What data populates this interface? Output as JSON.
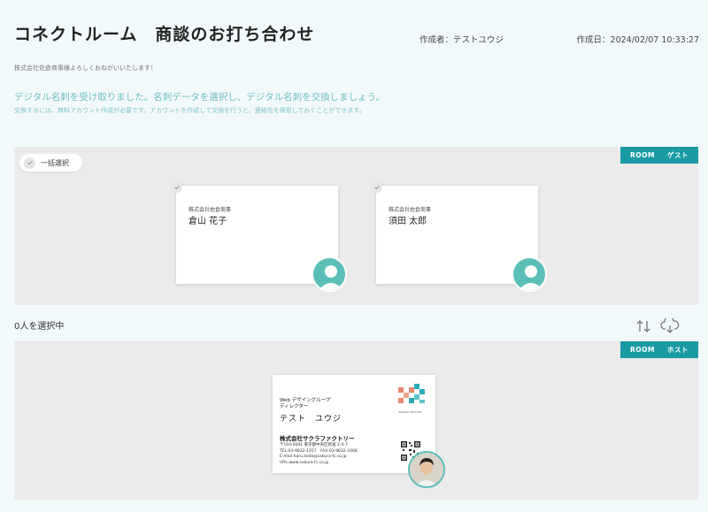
{
  "header": {
    "title": "コネクトルーム　商談のお打ち合わせ",
    "creator": "作成者：テストユウジ",
    "created": "作成日：2024/02/07 10:33:27"
  },
  "message": "株式会社佐倉商事様よろしくおねがいいたします！",
  "notice": {
    "main": "デジタル名刺を受け取りました。名刺データを選択し、デジタル名刺を交換しましょう。",
    "sub": "交換するには、無料アカウント作成が必要です。アカウントを作成して交換を行うと、連絡先を保管しておくことができます。"
  },
  "guest_panel": {
    "room_label": "ROOM",
    "role_label": "ゲスト",
    "select_all_label": "一括選択",
    "cards": [
      {
        "company": "株式会社佐倉商事",
        "name": "倉山 花子"
      },
      {
        "company": "株式会社佐倉商事",
        "name": "須田 太郎"
      }
    ]
  },
  "selection": {
    "count_text": "0人を選択中"
  },
  "toolbar": {
    "sort_icon": "sort-arrows-icon",
    "download_icon": "cloud-download-icon"
  },
  "host_panel": {
    "room_label": "ROOM",
    "role_label": "ホスト",
    "card": {
      "department": "Web デザイングループ",
      "role": "ディレクター",
      "name": "テスト　ユウジ",
      "company": "株式会社サクラファクトリー",
      "address": "〒104-0041 東京都中央区新富 2-4-7",
      "phone": "TEL:03-9632-1357　FAX:03-9632-2468",
      "email": "E-mail:haru.koda@sakura-fc.co.jp",
      "url": "URL:www.sakura-fc.co.jp",
      "brand": "SAKURA FACTORY"
    }
  },
  "colors": {
    "accent": "#1a9ba3",
    "avatar": "#5bbfb8",
    "notice": "#6bbfbf",
    "panel": "#ebebeb",
    "background": "#f2f9fb"
  }
}
